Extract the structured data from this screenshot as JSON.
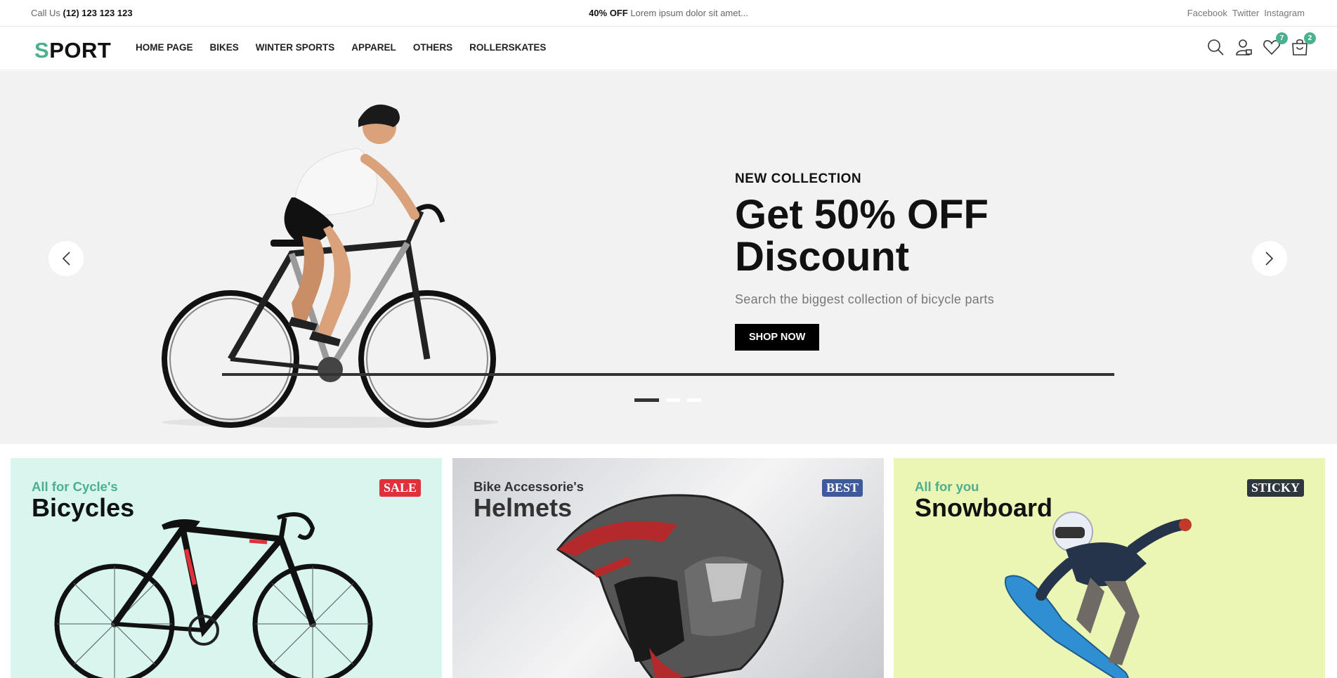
{
  "topbar": {
    "call_label": "Call Us",
    "phone": "(12) 123 123 123",
    "promo_bold": "40% OFF",
    "promo_text": "Lorem ipsum dolor sit amet...",
    "social": [
      "Facebook",
      "Twitter",
      "Instagram"
    ]
  },
  "header": {
    "logo_first": "S",
    "logo_rest": "PORT",
    "nav": [
      "HOME PAGE",
      "BIKES",
      "WINTER SPORTS",
      "APPAREL",
      "OTHERS",
      "ROLLERSKATES"
    ],
    "wishlist_count": "7",
    "cart_count": "2",
    "icons": [
      "search-icon",
      "user-icon",
      "heart-icon",
      "bag-icon"
    ]
  },
  "hero": {
    "subtitle": "NEW COLLECTION",
    "title_line1": "Get 50% OFF",
    "title_line2": "Discount",
    "description": "Search the biggest collection of bicycle parts",
    "button": "SHOP NOW",
    "slide_count": 3,
    "active_slide": 1,
    "bg_color": "#f2f2f2"
  },
  "cards": [
    {
      "subtitle": "All for Cycle's",
      "title": "Bicycles",
      "badge": "SALE",
      "badge_color": "#e0303a",
      "subtitle_color": "#4caf8f",
      "bg": "#d8f6ee"
    },
    {
      "subtitle": "Bike Accessorie's",
      "title": "Helmets",
      "badge": "BEST",
      "badge_color": "#3f5a9c",
      "subtitle_color": "#333333",
      "bg": "#e6e7e9"
    },
    {
      "subtitle": "All for you",
      "title": "Snowboard",
      "badge": "STICKY",
      "badge_color": "#2e3640",
      "subtitle_color": "#4caf8f",
      "bg": "#ecf6b4"
    }
  ],
  "colors": {
    "accent": "#4caf8f",
    "dark": "#111111"
  }
}
